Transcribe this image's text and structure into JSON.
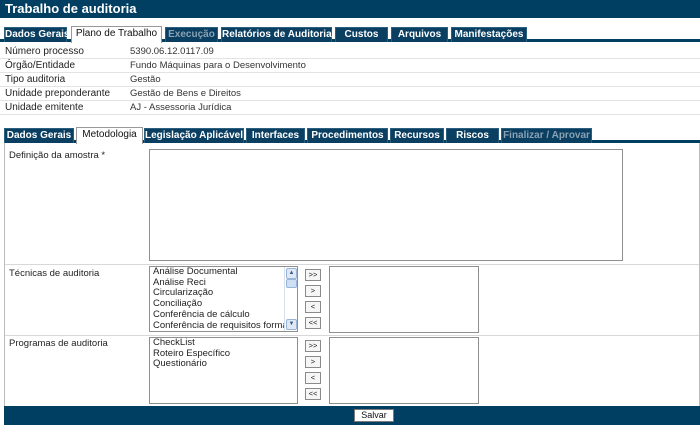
{
  "app": {
    "title": "Trabalho de auditoria"
  },
  "main_tabs": [
    {
      "label": "Dados Gerais"
    },
    {
      "label": "Plano de Trabalho"
    },
    {
      "label": "Execução"
    },
    {
      "label": "Relatórios de Auditoria"
    },
    {
      "label": "Custos"
    },
    {
      "label": "Arquivos"
    },
    {
      "label": "Manifestações"
    }
  ],
  "info": [
    {
      "label": "Número processo",
      "value": "5390.06.12.0117.09"
    },
    {
      "label": "Órgão/Entidade",
      "value": "Fundo Máquinas para o Desenvolvimento"
    },
    {
      "label": "Tipo auditoria",
      "value": "Gestão"
    },
    {
      "label": "Unidade preponderante",
      "value": "Gestão de Bens e Direitos"
    },
    {
      "label": "Unidade emitente",
      "value": "AJ - Assessoria Jurídica"
    }
  ],
  "sub_tabs": [
    {
      "label": "Dados Gerais"
    },
    {
      "label": "Metodologia"
    },
    {
      "label": "Legislação Aplicável"
    },
    {
      "label": "Interfaces"
    },
    {
      "label": "Procedimentos"
    },
    {
      "label": "Recursos"
    },
    {
      "label": "Riscos"
    },
    {
      "label": "Finalizar / Aprovar"
    }
  ],
  "form": {
    "sample_label": "Definição da amostra *",
    "sample_value": "",
    "techniques_label": "Técnicas de auditoria",
    "techniques": [
      "Análise Documental",
      "Análise Reci",
      "Circularização",
      "Conciliação",
      "Conferência de cálculo",
      "Conferência de requisitos formais"
    ],
    "programs_label": "Programas de auditoria",
    "programs": [
      "CheckList",
      "Roteiro Específico",
      "Questionário"
    ],
    "move_buttons": {
      "all_right": ">>",
      "right": ">",
      "left": "<",
      "all_left": "<<"
    }
  },
  "footer": {
    "save_label": "Salvar"
  },
  "colors": {
    "primary": "#003e62",
    "tab_disabled_text": "#8aa2b3"
  }
}
